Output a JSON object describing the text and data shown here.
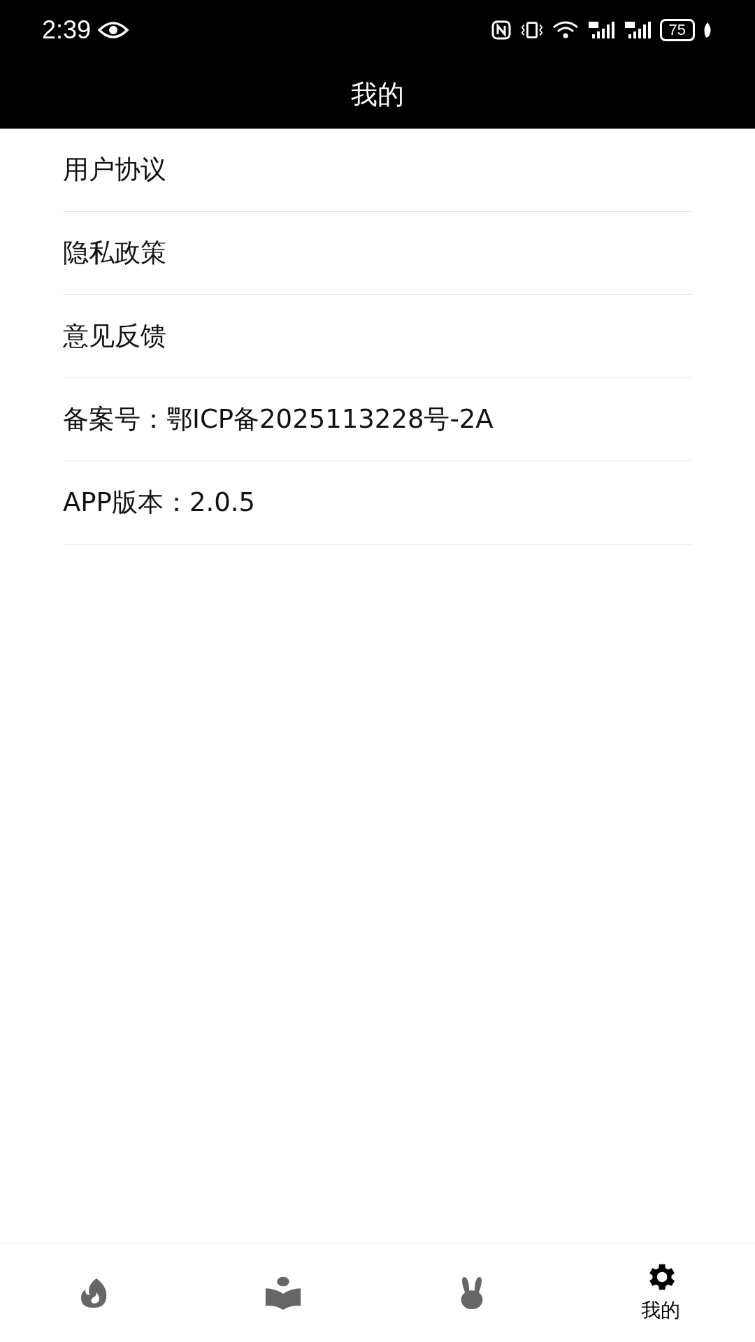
{
  "status_bar": {
    "time": "2:39",
    "battery": "75"
  },
  "header": {
    "title": "我的"
  },
  "menu": [
    {
      "label": "用户协议"
    },
    {
      "label": "隐私政策"
    },
    {
      "label": "意见反馈"
    },
    {
      "label": "备案号：鄂ICP备2025113228号-2A"
    },
    {
      "label": "APP版本：2.0.5"
    }
  ],
  "tab_bar": [
    {
      "kind": "flame",
      "selected": false
    },
    {
      "kind": "book",
      "selected": false
    },
    {
      "kind": "rabbit",
      "selected": false
    },
    {
      "kind": "gear",
      "selected": true,
      "label": "我的"
    }
  ]
}
